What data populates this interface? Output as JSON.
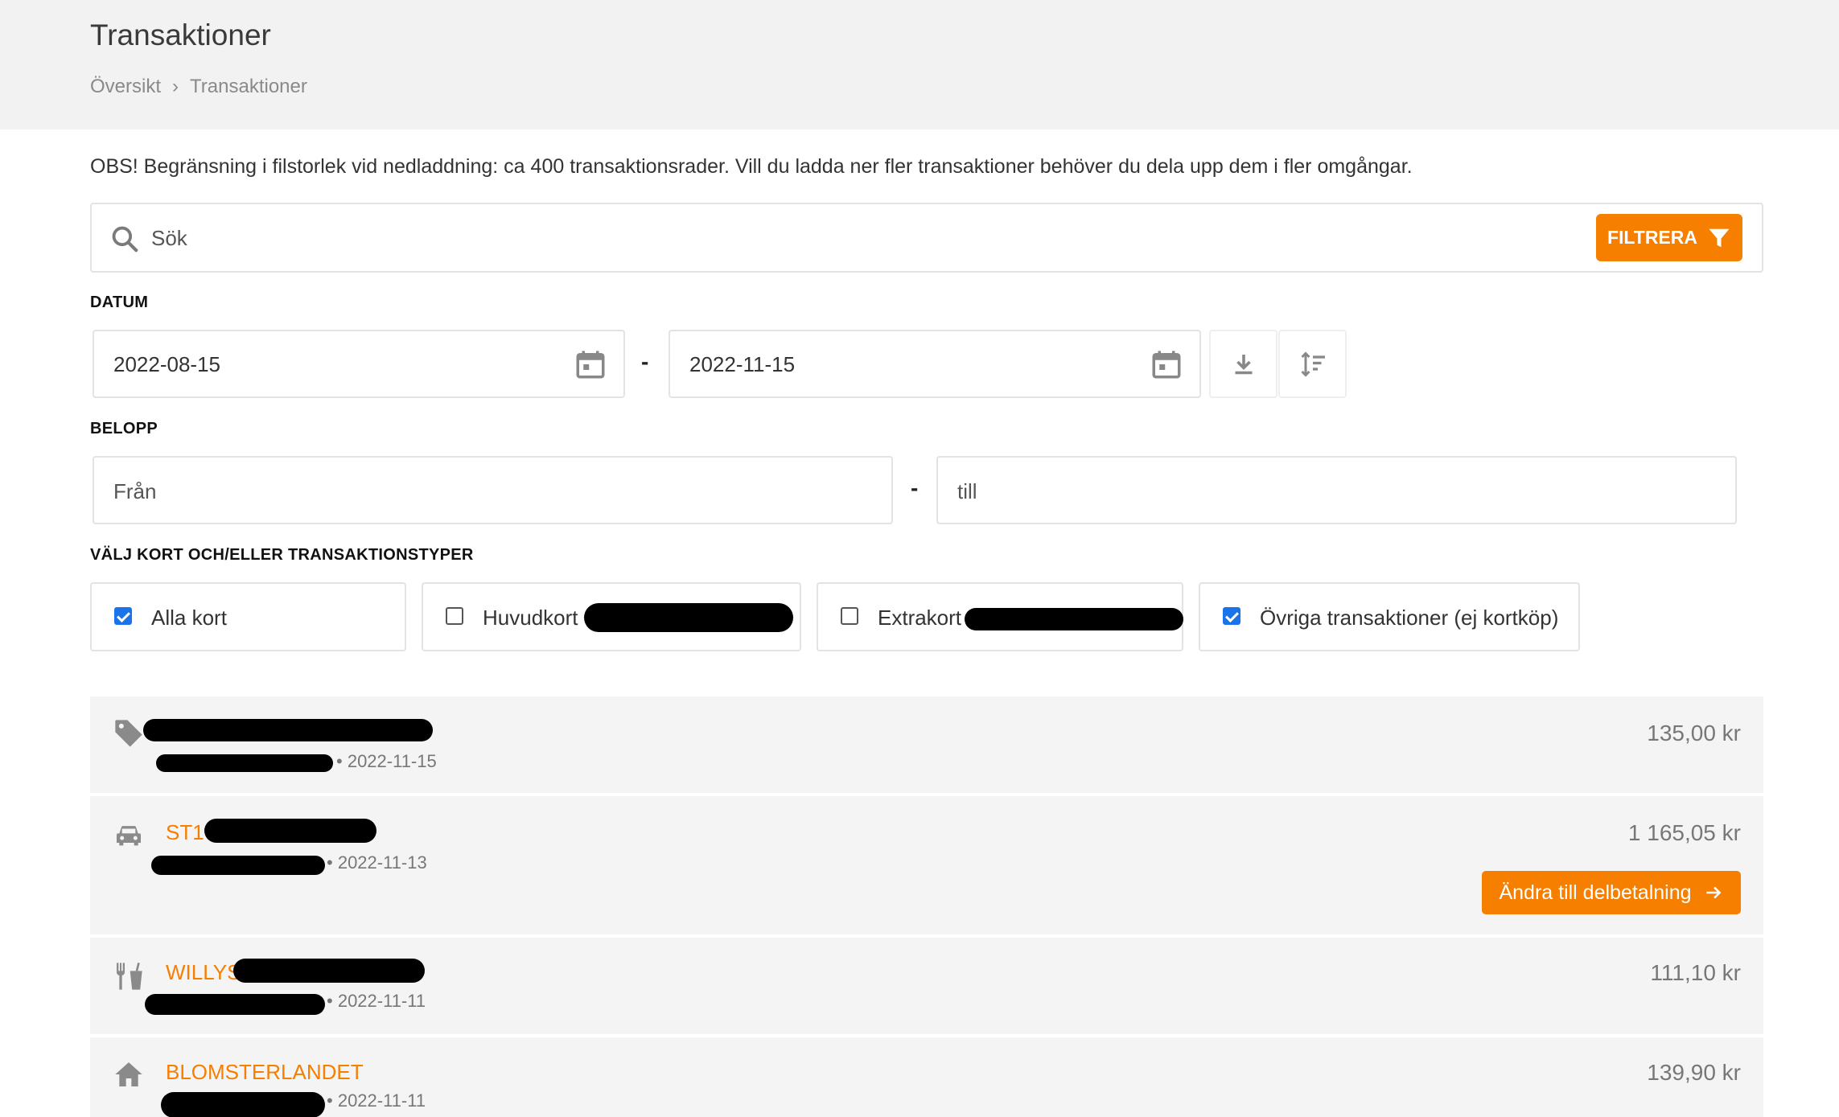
{
  "header": {
    "title": "Transaktioner",
    "breadcrumb": [
      {
        "label": "Översikt"
      },
      {
        "label": "Transaktioner"
      }
    ],
    "separator": "›"
  },
  "notice": "OBS! Begränsning i filstorlek vid nedladdning: ca 400 transaktionsrader. Vill du ladda ner fler transaktioner behöver du dela upp dem i fler omgångar.",
  "search": {
    "placeholder": "Sök",
    "icon": "search-icon",
    "filter_label": "FILTRERA",
    "filter_icon": "funnel-icon"
  },
  "date": {
    "label": "DATUM",
    "from": "2022-08-15",
    "to": "2022-11-15",
    "separator": "-",
    "actions": [
      {
        "icon": "download-icon"
      },
      {
        "icon": "sort-icon"
      }
    ]
  },
  "amount": {
    "label": "BELOPP",
    "from_placeholder": "Från",
    "to_placeholder": "till",
    "separator": "-"
  },
  "cards": {
    "label": "VÄLJ KORT OCH/ELLER TRANSAKTIONSTYPER",
    "options": [
      {
        "label": "Alla kort",
        "checked": true
      },
      {
        "label": "Huvudkort",
        "checked": false
      },
      {
        "label": "Extrakort",
        "checked": false
      },
      {
        "label": "Övriga transaktioner (ej kortköp)",
        "checked": true
      }
    ]
  },
  "transactions": [
    {
      "icon": "tag-icon",
      "merchant": "",
      "date": "2022-11-15",
      "amount": "135,00 kr"
    },
    {
      "icon": "car-icon",
      "merchant": "ST1",
      "date": "2022-11-13",
      "amount": "1 165,05 kr",
      "action": "Ändra till delbetalning"
    },
    {
      "icon": "restaurant-icon",
      "merchant": "WILLYS",
      "date": "2022-11-11",
      "amount": "111,10 kr"
    },
    {
      "icon": "home-icon",
      "merchant": "BLOMSTERLANDET",
      "date": "2022-11-11",
      "amount": "139,90 kr"
    }
  ],
  "colors": {
    "accent": "#f77f00",
    "header_bg": "#f2f2f2",
    "row_bg": "#f4f4f4",
    "checkbox": "#1a73e8"
  }
}
